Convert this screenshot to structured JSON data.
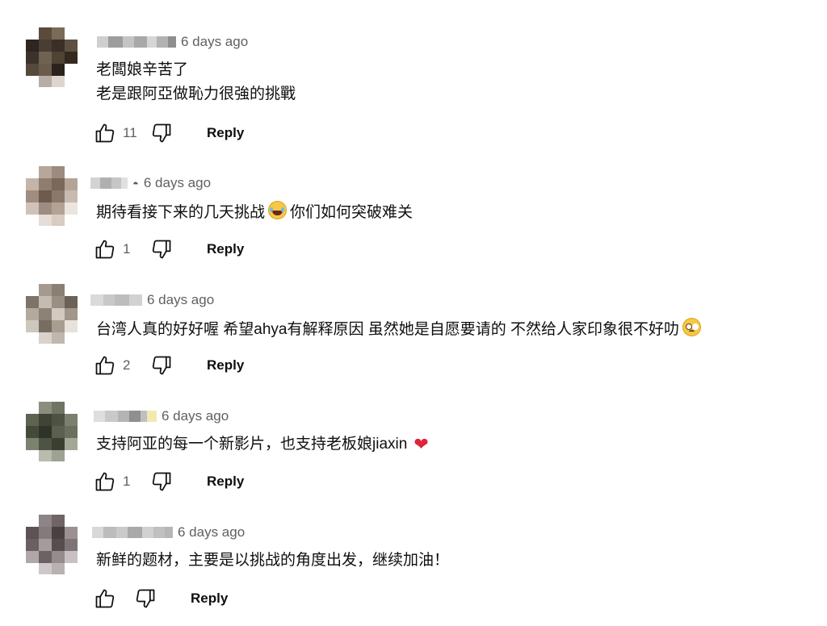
{
  "comments": [
    {
      "timestamp": "6 days ago",
      "lines": [
        "老闆娘辛苦了",
        "老是跟阿亞做恥力很強的挑戰"
      ],
      "likes": "11",
      "reply_label": "Reply"
    },
    {
      "timestamp": "6 days ago",
      "text_before_emoji": "期待看接下来的几天挑战",
      "emoji": "laughing-tears-emoji",
      "text_after_emoji": "你们如何突破难关",
      "likes": "1",
      "reply_label": "Reply"
    },
    {
      "timestamp": "6 days ago",
      "text_before_emoji": "台湾人真的好好喔 希望ahya有解释原因 虽然她是自愿要请的 不然给人家印象很不好叻",
      "emoji": "pleading-face-emoji",
      "likes": "2",
      "reply_label": "Reply"
    },
    {
      "timestamp": "6 days ago",
      "text_before_emoji": "支持阿亚的每一个新影片，也支持老板娘jiaxin",
      "emoji": "red-heart-emoji",
      "likes": "1",
      "reply_label": "Reply"
    },
    {
      "timestamp": "6 days ago",
      "lines": [
        "新鲜的题材，主要是以挑战的角度出发，继续加油！"
      ],
      "likes": "",
      "reply_label": "Reply"
    }
  ],
  "icons": {
    "like": "thumbs-up-icon",
    "dislike": "thumbs-down-icon"
  },
  "colors": {
    "text": "#0f0f0f",
    "secondary_text": "#606060",
    "heart": "#e0243a"
  }
}
